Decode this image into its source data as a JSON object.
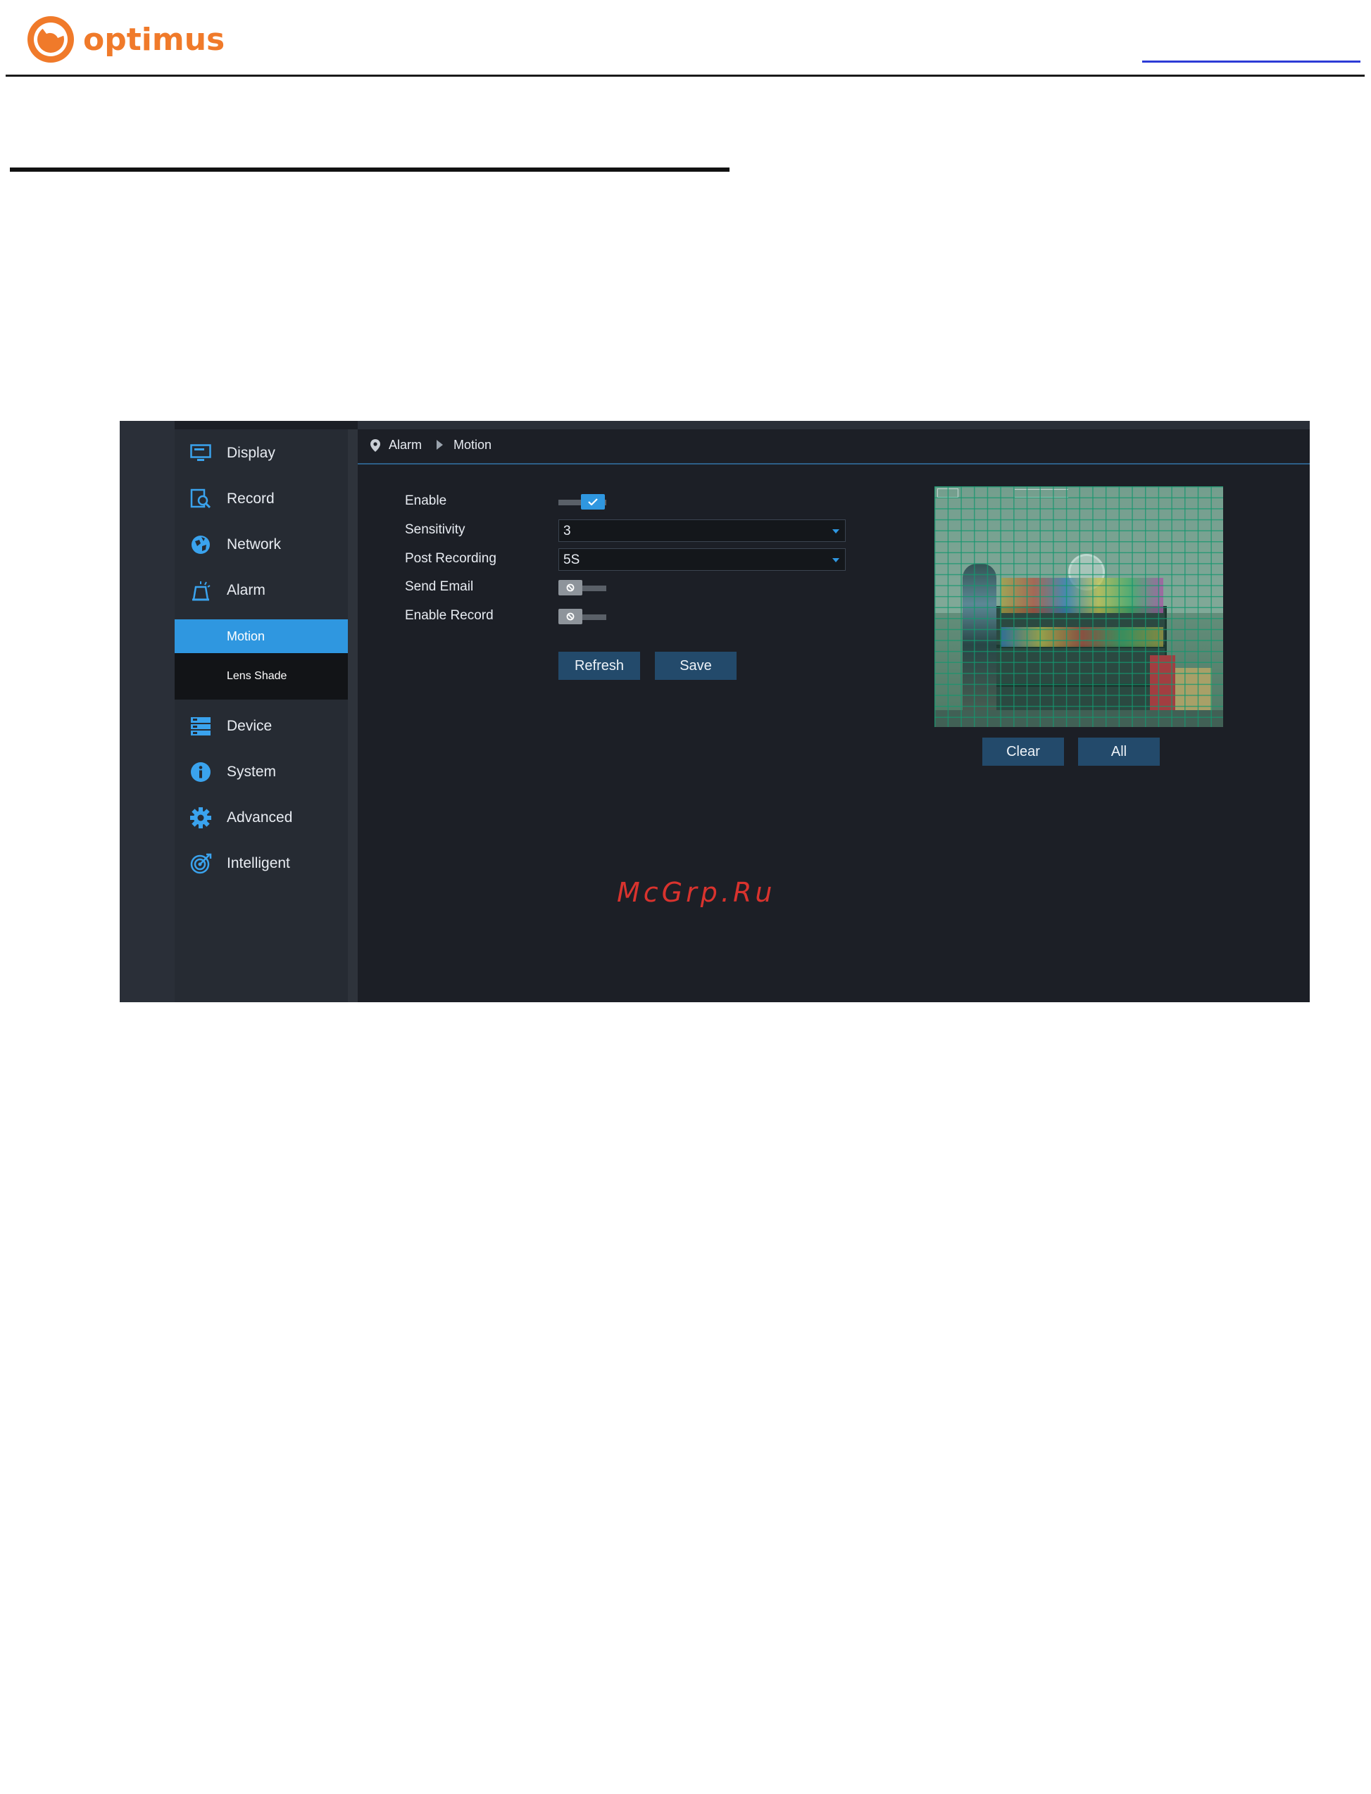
{
  "brand": {
    "name": "optimus",
    "color": "#f07a2a"
  },
  "colors": {
    "accent": "#2f97e0",
    "button": "#234a6b",
    "panel_bg": "#1c1f26",
    "sidebar_bg": "#262b33",
    "watermark": "#d9332e"
  },
  "sidebar": {
    "items": [
      {
        "label": "Display",
        "icon": "monitor-icon"
      },
      {
        "label": "Record",
        "icon": "record-search-icon"
      },
      {
        "label": "Network",
        "icon": "globe-icon"
      },
      {
        "label": "Alarm",
        "icon": "alarm-siren-icon"
      },
      {
        "label": "Device",
        "icon": "storage-device-icon"
      },
      {
        "label": "System",
        "icon": "info-icon"
      },
      {
        "label": "Advanced",
        "icon": "gear-icon"
      },
      {
        "label": "Intelligent",
        "icon": "target-icon"
      }
    ],
    "alarm_subitems": [
      {
        "label": "Motion",
        "active": true
      },
      {
        "label": "Lens Shade",
        "active": false
      }
    ]
  },
  "breadcrumb": {
    "section": "Alarm",
    "page": "Motion"
  },
  "form": {
    "enable_label": "Enable",
    "enable_value": true,
    "sensitivity_label": "Sensitivity",
    "sensitivity_value": "3",
    "post_recording_label": "Post Recording",
    "post_recording_value": "5S",
    "send_email_label": "Send Email",
    "send_email_value": false,
    "enable_record_label": "Enable Record",
    "enable_record_value": false
  },
  "buttons": {
    "refresh": "Refresh",
    "save": "Save",
    "clear": "Clear",
    "all": "All"
  },
  "watermark": "McGrp.Ru"
}
